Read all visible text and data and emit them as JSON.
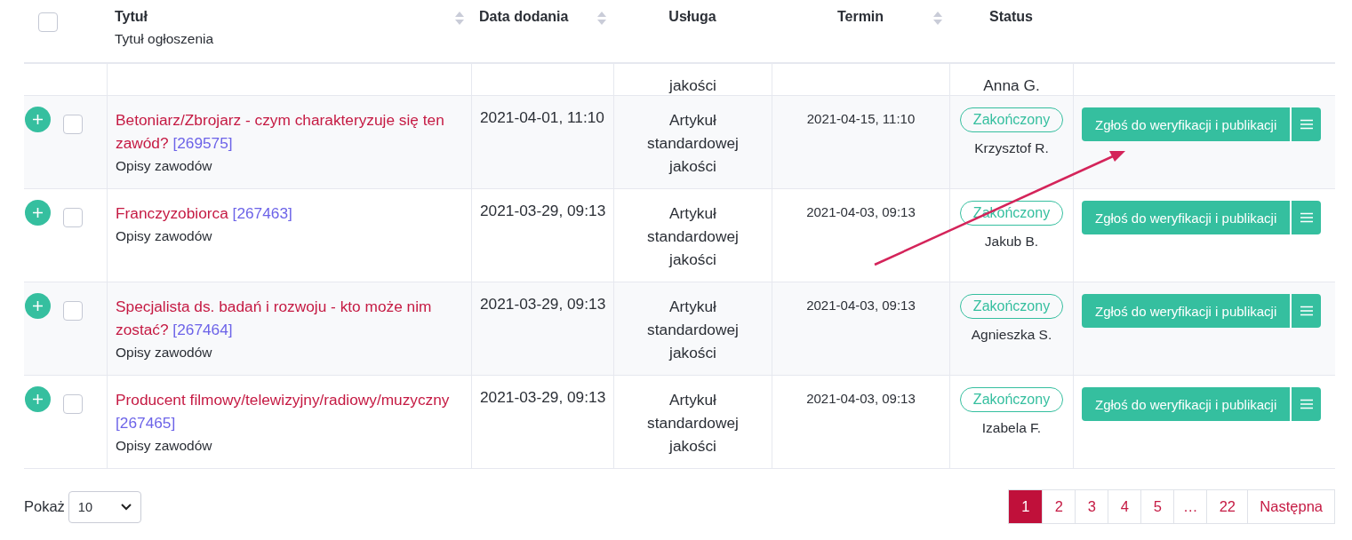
{
  "header": {
    "select_all": {
      "checked": false
    },
    "columns": [
      {
        "label": "Tytuł",
        "sublabel": "Tytuł ogłoszenia",
        "sortable": true
      },
      {
        "label": "Data dodania",
        "sortable": true
      },
      {
        "label": "Usługa",
        "sortable": false
      },
      {
        "label": "Termin",
        "sortable": true
      },
      {
        "label": "Status",
        "sortable": false
      }
    ]
  },
  "partial_row": {
    "service": "jakości",
    "author": "Anna G."
  },
  "rows": [
    {
      "checked": false,
      "title": "Betoniarz/Zbrojarz - czym charakteryzuje się ten zawód?",
      "ref": "[269575]",
      "category": "Opisy zawodów",
      "date": "2021-04-01, 11:10",
      "service": "Artykuł standardowej jakości",
      "deadline": "2021-04-15, 11:10",
      "status": "Zakończony",
      "author": "Krzysztof R.",
      "action": "Zgłoś do weryfikacji i publikacji"
    },
    {
      "checked": false,
      "title": "Franczyzobiorca",
      "ref": "[267463]",
      "category": "Opisy zawodów",
      "date": "2021-03-29, 09:13",
      "service": "Artykuł standardowej jakości",
      "deadline": "2021-04-03, 09:13",
      "status": "Zakończony",
      "author": "Jakub B.",
      "action": "Zgłoś do weryfikacji i publikacji"
    },
    {
      "checked": false,
      "title": "Specjalista ds. badań i rozwoju - kto może nim zostać?",
      "ref": "[267464]",
      "category": "Opisy zawodów",
      "date": "2021-03-29, 09:13",
      "service": "Artykuł standardowej jakości",
      "deadline": "2021-04-03, 09:13",
      "status": "Zakończony",
      "author": "Agnieszka S.",
      "action": "Zgłoś do weryfikacji i publikacji"
    },
    {
      "checked": false,
      "title": "Producent filmowy/telewizyjny/radiowy/muzyczny",
      "ref": "[267465]",
      "category": "Opisy zawodów",
      "date": "2021-03-29, 09:13",
      "service": "Artykuł standardowej jakości",
      "deadline": "2021-04-03, 09:13",
      "status": "Zakończony",
      "author": "Izabela F.",
      "action": "Zgłoś do weryfikacji i publikacji"
    }
  ],
  "page_size": {
    "label": "Pokaż",
    "value": "10"
  },
  "pagination": {
    "pages": [
      {
        "label": "1",
        "selected": true
      },
      {
        "label": "2",
        "selected": false
      },
      {
        "label": "3",
        "selected": false
      },
      {
        "label": "4",
        "selected": false
      },
      {
        "label": "5",
        "selected": false
      },
      {
        "label": "…",
        "selected": false
      },
      {
        "label": "22",
        "selected": false
      }
    ],
    "next": "Następna"
  }
}
